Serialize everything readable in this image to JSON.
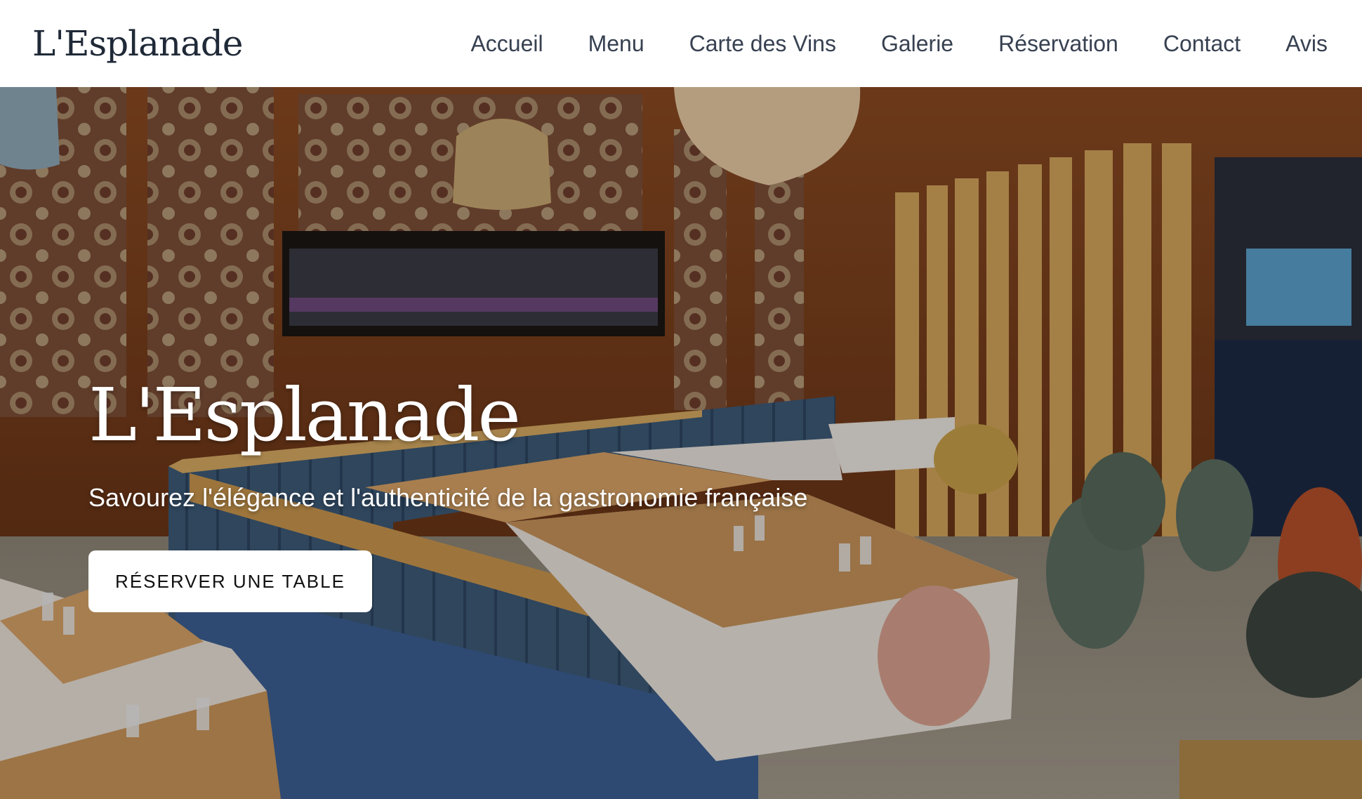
{
  "site": {
    "brand": "L'Esplanade"
  },
  "nav": {
    "links": [
      {
        "label": "Accueil"
      },
      {
        "label": "Menu"
      },
      {
        "label": "Carte des Vins"
      },
      {
        "label": "Galerie"
      },
      {
        "label": "Réservation"
      },
      {
        "label": "Contact"
      },
      {
        "label": "Avis"
      }
    ]
  },
  "hero": {
    "title": "L'Esplanade",
    "subtitle": "Savourez l'élégance et l'authenticité de la gastronomie française",
    "cta_label": "RÉSERVER UNE TABLE",
    "background_image": "restaurant-interior-photo"
  },
  "colors": {
    "nav_bg": "#ffffff",
    "nav_text": "#374151",
    "brand_text": "#1f2937",
    "hero_text": "#ffffff",
    "cta_bg": "#ffffff",
    "cta_text": "#111111"
  }
}
